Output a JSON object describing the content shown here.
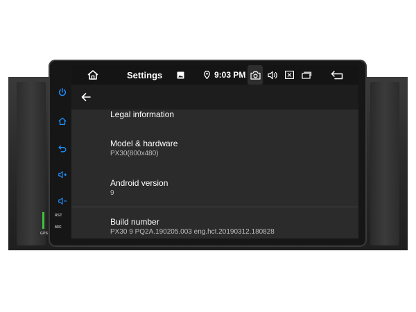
{
  "status_bar": {
    "title": "Settings",
    "time": "9:03 PM"
  },
  "settings": {
    "items": [
      {
        "title": "Legal information",
        "subtitle": ""
      },
      {
        "title": "Model & hardware",
        "subtitle": "PX30(800x480)"
      },
      {
        "title": "Android version",
        "subtitle": "9"
      },
      {
        "title": "Build number",
        "subtitle": "PX30 9 PQ2A.190205.003 eng.hct.20190312.180828"
      }
    ]
  },
  "hardware": {
    "rst_label": "RST",
    "mic_label": "MIC",
    "gps_label": "GPS"
  },
  "colors": {
    "side_button_blue": "#1e90ff",
    "gps_led_green": "#3ec43e",
    "screen_background": "#2b2b2b",
    "status_bar_background": "#141414"
  },
  "icons": {
    "status_bar": [
      "home-icon",
      "image-icon",
      "location-pin-icon",
      "camera-icon",
      "volume-icon",
      "close-box-icon",
      "recent-apps-icon",
      "back-icon"
    ],
    "side_buttons": [
      "power-icon",
      "home-icon",
      "back-icon",
      "volume-up-icon",
      "volume-down-icon"
    ],
    "app_bar": [
      "arrow-left-icon"
    ]
  }
}
